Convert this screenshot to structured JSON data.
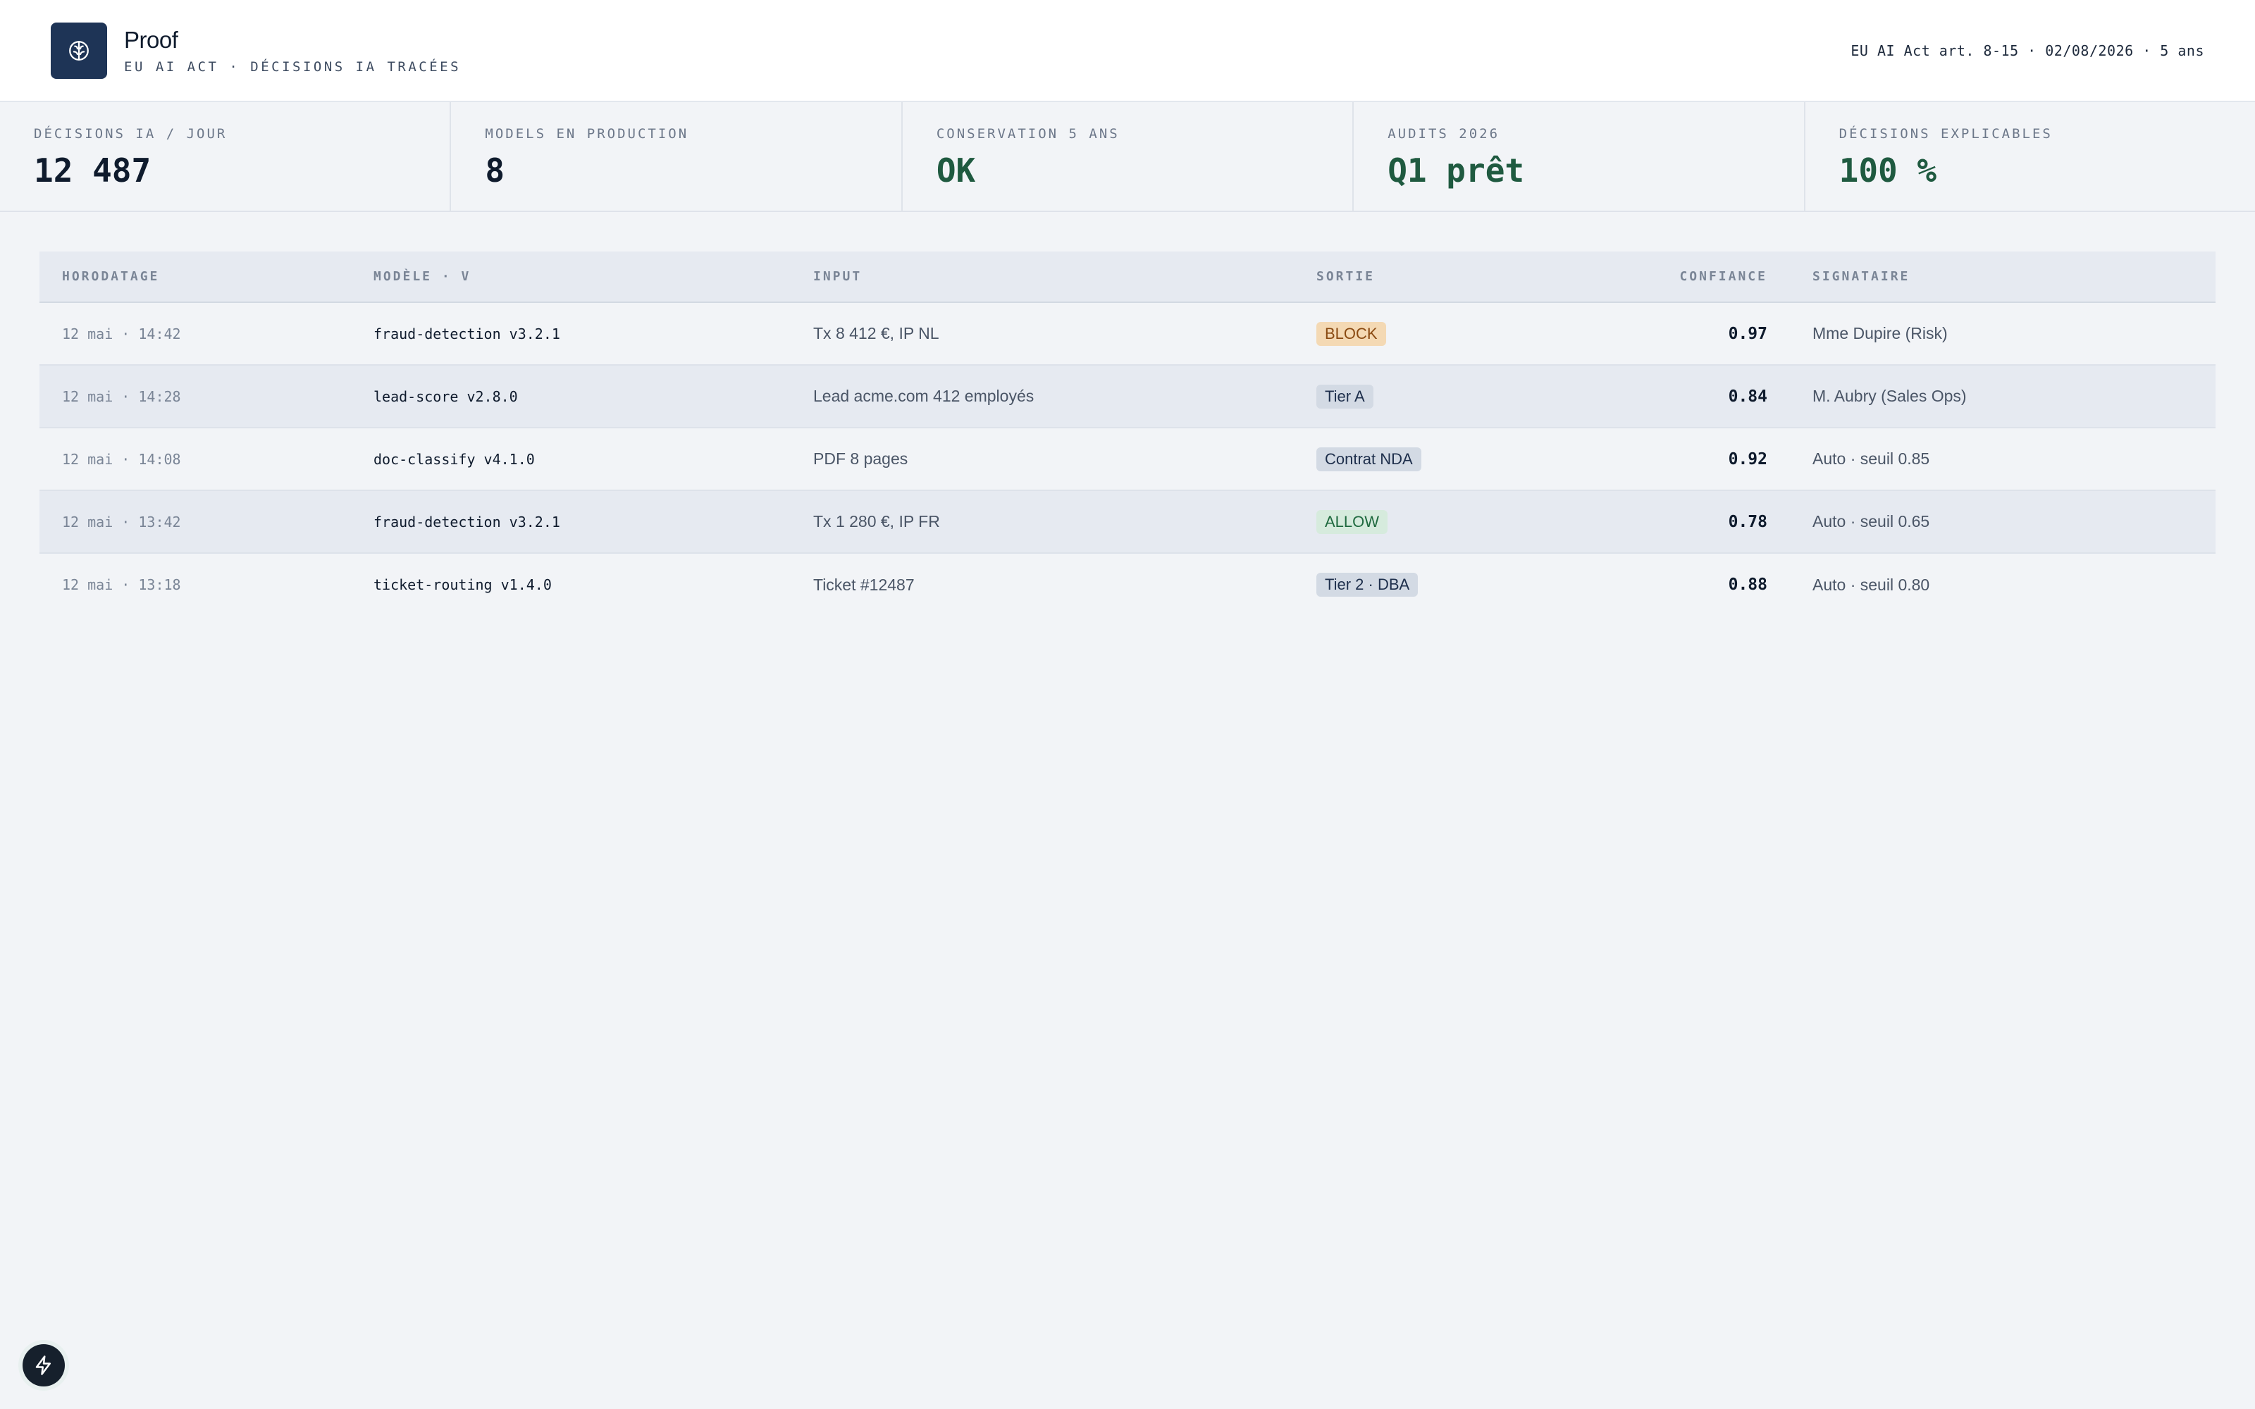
{
  "app": {
    "title": "Proof",
    "subtitle": "EU AI ACT · DÉCISIONS IA TRACÉES",
    "meta": "EU AI Act art. 8-15 · 02/08/2026 · 5 ans",
    "logo_icon": "brain-icon",
    "accent_color": "#1e3456"
  },
  "kpis": [
    {
      "label": "DÉCISIONS IA / JOUR",
      "value": "12 487",
      "tone": "default"
    },
    {
      "label": "MODELS EN PRODUCTION",
      "value": "8",
      "tone": "default"
    },
    {
      "label": "CONSERVATION 5 ANS",
      "value": "OK",
      "tone": "green"
    },
    {
      "label": "AUDITS 2026",
      "value": "Q1 prêt",
      "tone": "green"
    },
    {
      "label": "DÉCISIONS EXPLICABLES",
      "value": "100 %",
      "tone": "green"
    }
  ],
  "table": {
    "columns": [
      "HORODATAGE",
      "MODÈLE · V",
      "INPUT",
      "SORTIE",
      "CONFIANCE",
      "SIGNATAIRE"
    ],
    "rows": [
      {
        "timestamp": "12 mai · 14:42",
        "model": "fraud-detection v3.2.1",
        "input": "Tx 8 412 €, IP NL",
        "output": "BLOCK",
        "output_tone": "block",
        "confidence": "0.97",
        "signatory": "Mme Dupire (Risk)"
      },
      {
        "timestamp": "12 mai · 14:28",
        "model": "lead-score v2.8.0",
        "input": "Lead acme.com 412 employés",
        "output": "Tier A",
        "output_tone": "neutral",
        "confidence": "0.84",
        "signatory": "M. Aubry (Sales Ops)"
      },
      {
        "timestamp": "12 mai · 14:08",
        "model": "doc-classify v4.1.0",
        "input": "PDF 8 pages",
        "output": "Contrat NDA",
        "output_tone": "neutral",
        "confidence": "0.92",
        "signatory": "Auto · seuil 0.85"
      },
      {
        "timestamp": "12 mai · 13:42",
        "model": "fraud-detection v3.2.1",
        "input": "Tx 1 280 €, IP FR",
        "output": "ALLOW",
        "output_tone": "allow",
        "confidence": "0.78",
        "signatory": "Auto · seuil 0.65"
      },
      {
        "timestamp": "12 mai · 13:18",
        "model": "ticket-routing v1.4.0",
        "input": "Ticket #12487",
        "output": "Tier 2 · DBA",
        "output_tone": "neutral",
        "confidence": "0.88",
        "signatory": "Auto · seuil 0.80"
      }
    ]
  },
  "fab": {
    "icon": "lightning-icon"
  }
}
